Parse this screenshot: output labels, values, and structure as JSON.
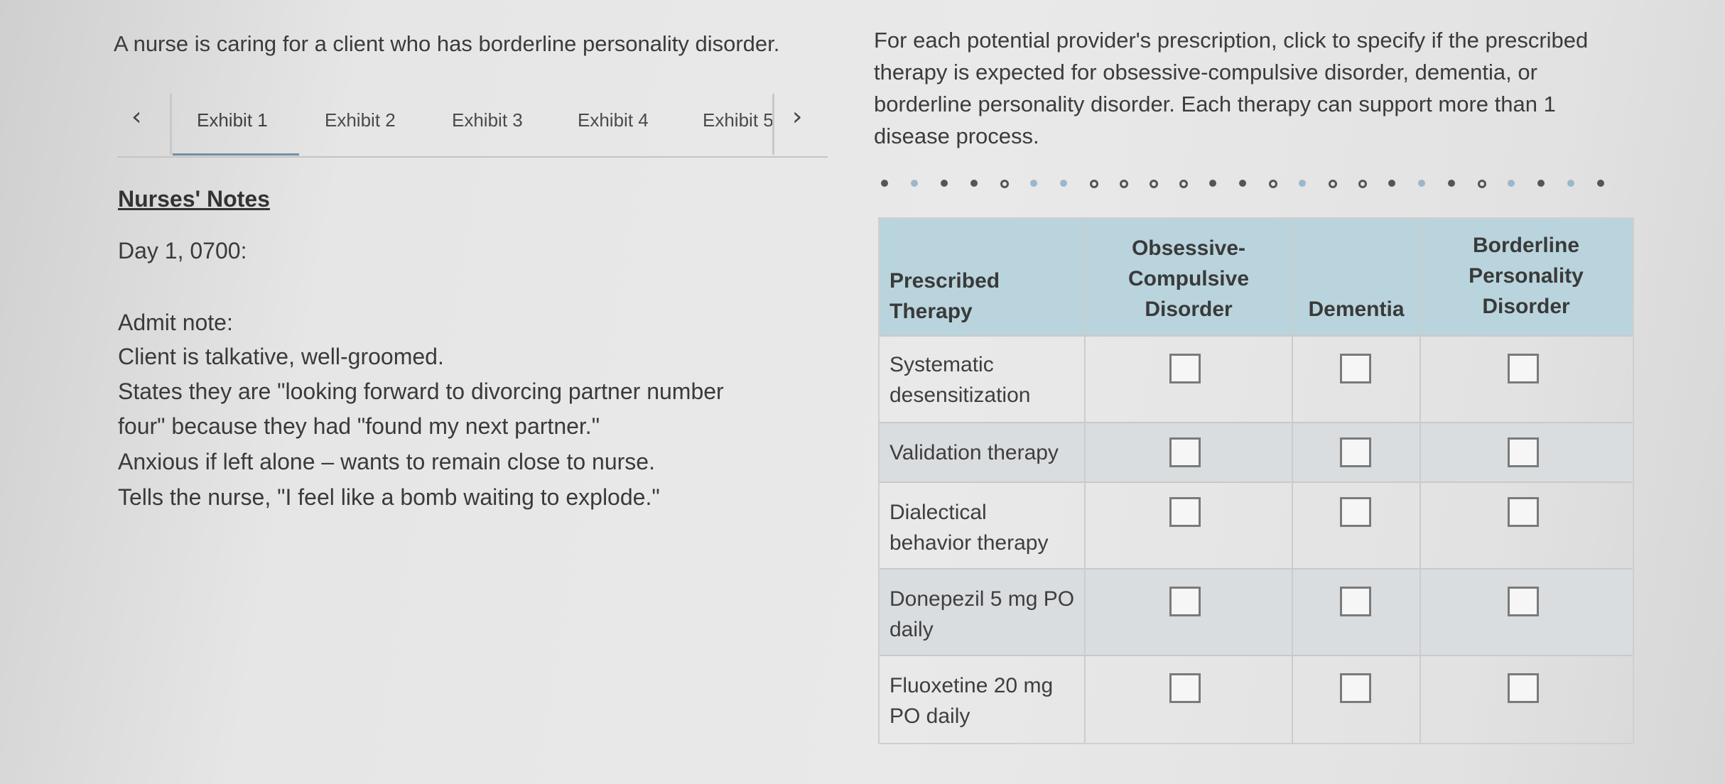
{
  "stem": "A nurse is caring for a client who has borderline personality disorder.",
  "tabs": {
    "prev_icon": "chevron-left-icon",
    "next_icon": "chevron-right-icon",
    "items": [
      "Exhibit 1",
      "Exhibit 2",
      "Exhibit 3",
      "Exhibit 4",
      "Exhibit 5"
    ],
    "active_index": 0
  },
  "notes": {
    "heading": "Nurses' Notes",
    "timestamp": "Day 1, 0700:",
    "admit_label": "Admit note:",
    "lines": [
      "Client is talkative, well-groomed.",
      "States they are \"looking forward to divorcing partner number",
      "four\" because they had \"found my next partner.\"",
      "Anxious if left alone – wants to remain close to nurse.",
      "Tells the nurse, \"I feel like a bomb waiting to explode.\""
    ]
  },
  "instructions": "For each potential provider's prescription, click to specify if the prescribed therapy is expected for obsessive-compulsive disorder, dementia, or borderline personality disorder. Each therapy can support more than 1 disease process.",
  "table": {
    "headers": {
      "therapy": [
        "Prescribed",
        "Therapy"
      ],
      "ocd": [
        "Obsessive-",
        "Compulsive",
        "Disorder"
      ],
      "dementia": [
        "Dementia"
      ],
      "bpd": [
        "Borderline",
        "Personality",
        "Disorder"
      ]
    },
    "rows": [
      {
        "therapy": [
          "Systematic",
          "desensitization"
        ],
        "checks": [
          false,
          false,
          false
        ]
      },
      {
        "therapy": [
          "Validation therapy"
        ],
        "checks": [
          false,
          false,
          false
        ]
      },
      {
        "therapy": [
          "Dialectical",
          "behavior therapy"
        ],
        "checks": [
          false,
          false,
          false
        ]
      },
      {
        "therapy": [
          "Donepezil 5 mg PO",
          "daily"
        ],
        "checks": [
          false,
          false,
          false
        ]
      },
      {
        "therapy": [
          "Fluoxetine 20 mg",
          "PO daily"
        ],
        "checks": [
          false,
          false,
          false
        ]
      }
    ]
  },
  "colors": {
    "header_bg": "#b9d4dd",
    "tab_underline": "#6f8fa8"
  }
}
